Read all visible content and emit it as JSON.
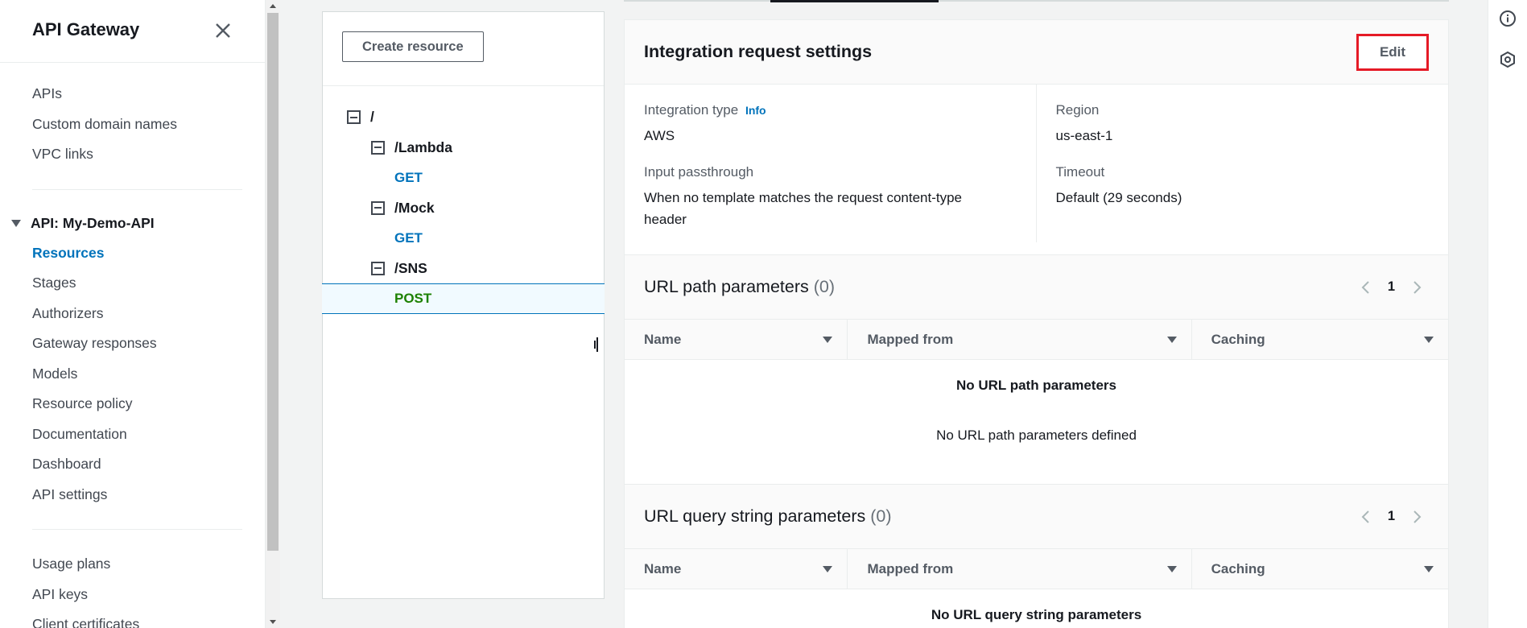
{
  "nav": {
    "title": "API Gateway",
    "top_links": [
      {
        "label": "APIs"
      },
      {
        "label": "Custom domain names"
      },
      {
        "label": "VPC links"
      }
    ],
    "api_section": "API: My-Demo-API",
    "api_links": [
      {
        "label": "Resources",
        "active": true
      },
      {
        "label": "Stages"
      },
      {
        "label": "Authorizers"
      },
      {
        "label": "Gateway responses"
      },
      {
        "label": "Models"
      },
      {
        "label": "Resource policy"
      },
      {
        "label": "Documentation"
      },
      {
        "label": "Dashboard"
      },
      {
        "label": "API settings"
      }
    ],
    "bottom_links": [
      {
        "label": "Usage plans"
      },
      {
        "label": "API keys"
      },
      {
        "label": "Client certificates"
      }
    ]
  },
  "resources": {
    "create_button": "Create resource",
    "tree": {
      "root": "/",
      "lambda": "/Lambda",
      "lambda_get": "GET",
      "mock": "/Mock",
      "mock_get": "GET",
      "sns": "/SNS",
      "sns_post": "POST"
    }
  },
  "integration": {
    "title": "Integration request settings",
    "edit_button": "Edit",
    "integration_type_label": "Integration type",
    "info_link": "Info",
    "integration_type_value": "AWS",
    "input_passthrough_label": "Input passthrough",
    "input_passthrough_value": "When no template matches the request content-type header",
    "region_label": "Region",
    "region_value": "us-east-1",
    "timeout_label": "Timeout",
    "timeout_value": "Default (29 seconds)"
  },
  "url_path": {
    "title": "URL path parameters",
    "count": "(0)",
    "page": "1",
    "columns": [
      "Name",
      "Mapped from",
      "Caching"
    ],
    "empty_title": "No URL path parameters",
    "empty_desc": "No URL path parameters defined"
  },
  "url_query": {
    "title": "URL query string parameters",
    "count": "(0)",
    "page": "1",
    "columns": [
      "Name",
      "Mapped from",
      "Caching"
    ],
    "empty_title": "No URL query string parameters"
  },
  "colors": {
    "accent": "#0073bb",
    "post": "#1d8102",
    "highlight": "#e51a26"
  }
}
